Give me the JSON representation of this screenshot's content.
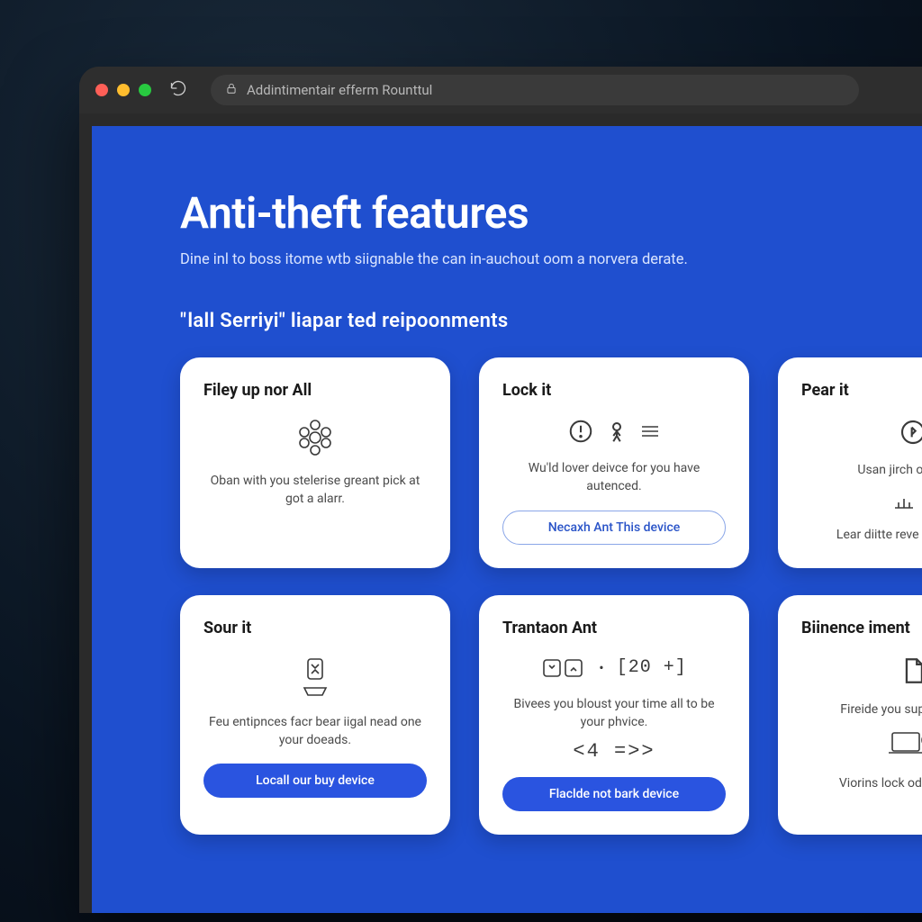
{
  "browser": {
    "url": "Addintimentair efferm Rounttul"
  },
  "page": {
    "title": "Anti-theft features",
    "subtitle": "Dine inl to boss itome wtb siignable the can in-auchout oom a norvera derate.",
    "section_heading": "lall Serriyi\" liapar ted reipoonments"
  },
  "cards": [
    {
      "title": "Filey up nor All",
      "desc": "Oban with you stelerise greant pick at got a alarr."
    },
    {
      "title": "Lock it",
      "desc": "Wu'ld lover deivce for you have autenced.",
      "action": "Necaxh Ant This device"
    },
    {
      "title": "Pear it",
      "desc": "Usan jirch on dem o",
      "desc2": "Lear diitte reve ditalls . fack"
    },
    {
      "title": "Sour it",
      "desc": "Feu entipnces facr bear iigal nead one your doeads.",
      "action": "Locall our buy device"
    },
    {
      "title": "Trantaon Ant",
      "extra_code": "[20 +]",
      "desc": "Bivees you bloust your time all to be your phvice.",
      "extra_code2": "<4 =>>",
      "action": "Flaclde not bark device"
    },
    {
      "title": "Biinence iment",
      "desc": "Fireide you supn link pnati",
      "desc2": "Viorins lock od to fill to pia"
    }
  ]
}
